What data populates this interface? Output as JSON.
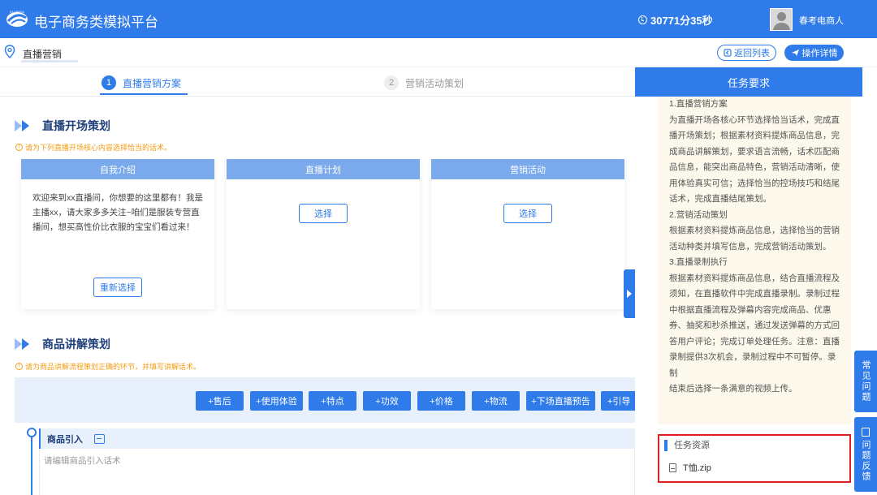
{
  "header": {
    "app_title": "电子商务类模拟平台",
    "timer": "30771分35秒",
    "username": "春考电商人",
    "logo_text": "ELLPASA"
  },
  "breadcrumb": {
    "current": "直播营销",
    "back_label": "返回列表",
    "ops_label": "操作详情"
  },
  "steps": [
    {
      "num": "1",
      "label": "直播营销方案"
    },
    {
      "num": "2",
      "label": "营销活动策划"
    }
  ],
  "section1": {
    "title": "直播开场策划",
    "hint": "请为下列直播开场核心内容选择恰当的话术。",
    "cards": [
      {
        "title": "自我介绍",
        "text": "欢迎来到xx直播间，你想要的这里都有！我是主播xx，请大家多多关注~咱们是服装专营直播间，想买高性价比衣服的宝宝们看过来！",
        "button": "重新选择"
      },
      {
        "title": "直播计划",
        "text": "",
        "button": "选择"
      },
      {
        "title": "营销活动",
        "text": "",
        "button": "选择"
      }
    ]
  },
  "section2": {
    "title": "商品讲解策划",
    "hint": "请为商品讲解流程策划正确的环节，并填写讲解话术。",
    "tags": [
      "+售后",
      "+使用体验",
      "+特点",
      "+功效",
      "+价格",
      "+物流",
      "+下场直播预告",
      "+引导"
    ],
    "intro_title": "商品引入",
    "intro_placeholder": "请编辑商品引入话术"
  },
  "task_panel": {
    "title": "任务要求",
    "lines": [
      "1.直播营销方案",
      "为直播开场各核心环节选择恰当话术，完成直",
      "播开场策划；根据素材资料提炼商品信息，完",
      "成商品讲解策划，要求语言流畅，话术匹配商",
      "品信息，能突出商品特色，营销活动清晰，使",
      "用体验真实可信；选择恰当的控场技巧和结尾",
      "话术，完成直播结尾策划。",
      "2.营销活动策划",
      "根据素材资料提炼商品信息，选择恰当的营销",
      "活动种类并填写信息，完成营销活动策划。",
      "3.直播录制执行",
      "根据素材资料提炼商品信息，结合直播流程及",
      "须知，在直播软件中完成直播录制。录制过程",
      "中根据直播流程及弹幕内容完成商品、优惠",
      "券、抽奖和秒杀推送，通过发送弹幕的方式回",
      "答用户评论；完成订单处理任务。注意：直播",
      "录制提供3次机会，录制过程中不可暂停。录制",
      "结束后选择一条满意的视频上传。"
    ],
    "resource_title": "任务资源",
    "resource_file": "T恤.zip"
  },
  "side_tabs": {
    "faq": "常见问题",
    "feedback": "问题反馈"
  },
  "colors": {
    "primary": "#2f7bea",
    "card_header": "#7aa9ec",
    "hint": "#f39c12",
    "highlight_border": "#e02020"
  }
}
